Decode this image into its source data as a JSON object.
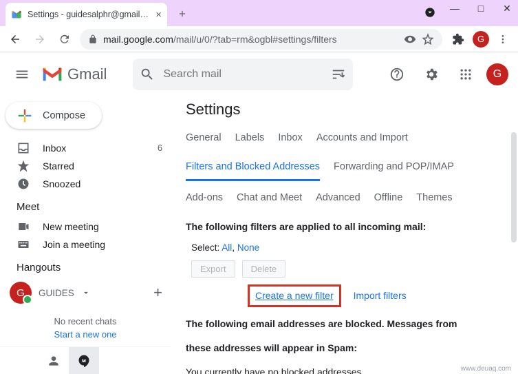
{
  "browser": {
    "tab_title": "Settings - guidesalphr@gmail.co",
    "url_host": "mail.google.com",
    "url_path": "/mail/u/0/?tab=rm&ogbl#settings/filters",
    "avatar_initial": "G"
  },
  "gmail": {
    "logo_text": "Gmail",
    "search_placeholder": "Search mail",
    "avatar_initial": "G",
    "compose_label": "Compose",
    "sidebar": {
      "items": [
        {
          "label": "Inbox",
          "count": "6"
        },
        {
          "label": "Starred"
        },
        {
          "label": "Snoozed"
        }
      ]
    },
    "meet": {
      "title": "Meet",
      "new_meeting": "New meeting",
      "join_meeting": "Join a meeting"
    },
    "hangouts": {
      "title": "Hangouts",
      "name": "GUIDES",
      "avatar_initial": "G",
      "no_chats": "No recent chats",
      "start_one": "Start a new one"
    }
  },
  "settings": {
    "title": "Settings",
    "tabs1": [
      "General",
      "Labels",
      "Inbox",
      "Accounts and Import"
    ],
    "tabs2": [
      "Filters and Blocked Addresses",
      "Forwarding and POP/IMAP"
    ],
    "tabs3": [
      "Add-ons",
      "Chat and Meet",
      "Advanced",
      "Offline",
      "Themes"
    ],
    "active_tab": "Filters and Blocked Addresses",
    "filters_applied": "The following filters are applied to all incoming mail:",
    "select_label": "Select:",
    "select_all": "All",
    "select_none": "None",
    "export_btn": "Export",
    "delete_btn": "Delete",
    "create_filter": "Create a new filter",
    "import_filters": "Import filters",
    "blocked_heading1": "The following email addresses are blocked. Messages from",
    "blocked_heading2": "these addresses will appear in Spam:",
    "no_blocked": "You currently have no blocked addresses."
  },
  "watermark": "www.deuaq.com"
}
